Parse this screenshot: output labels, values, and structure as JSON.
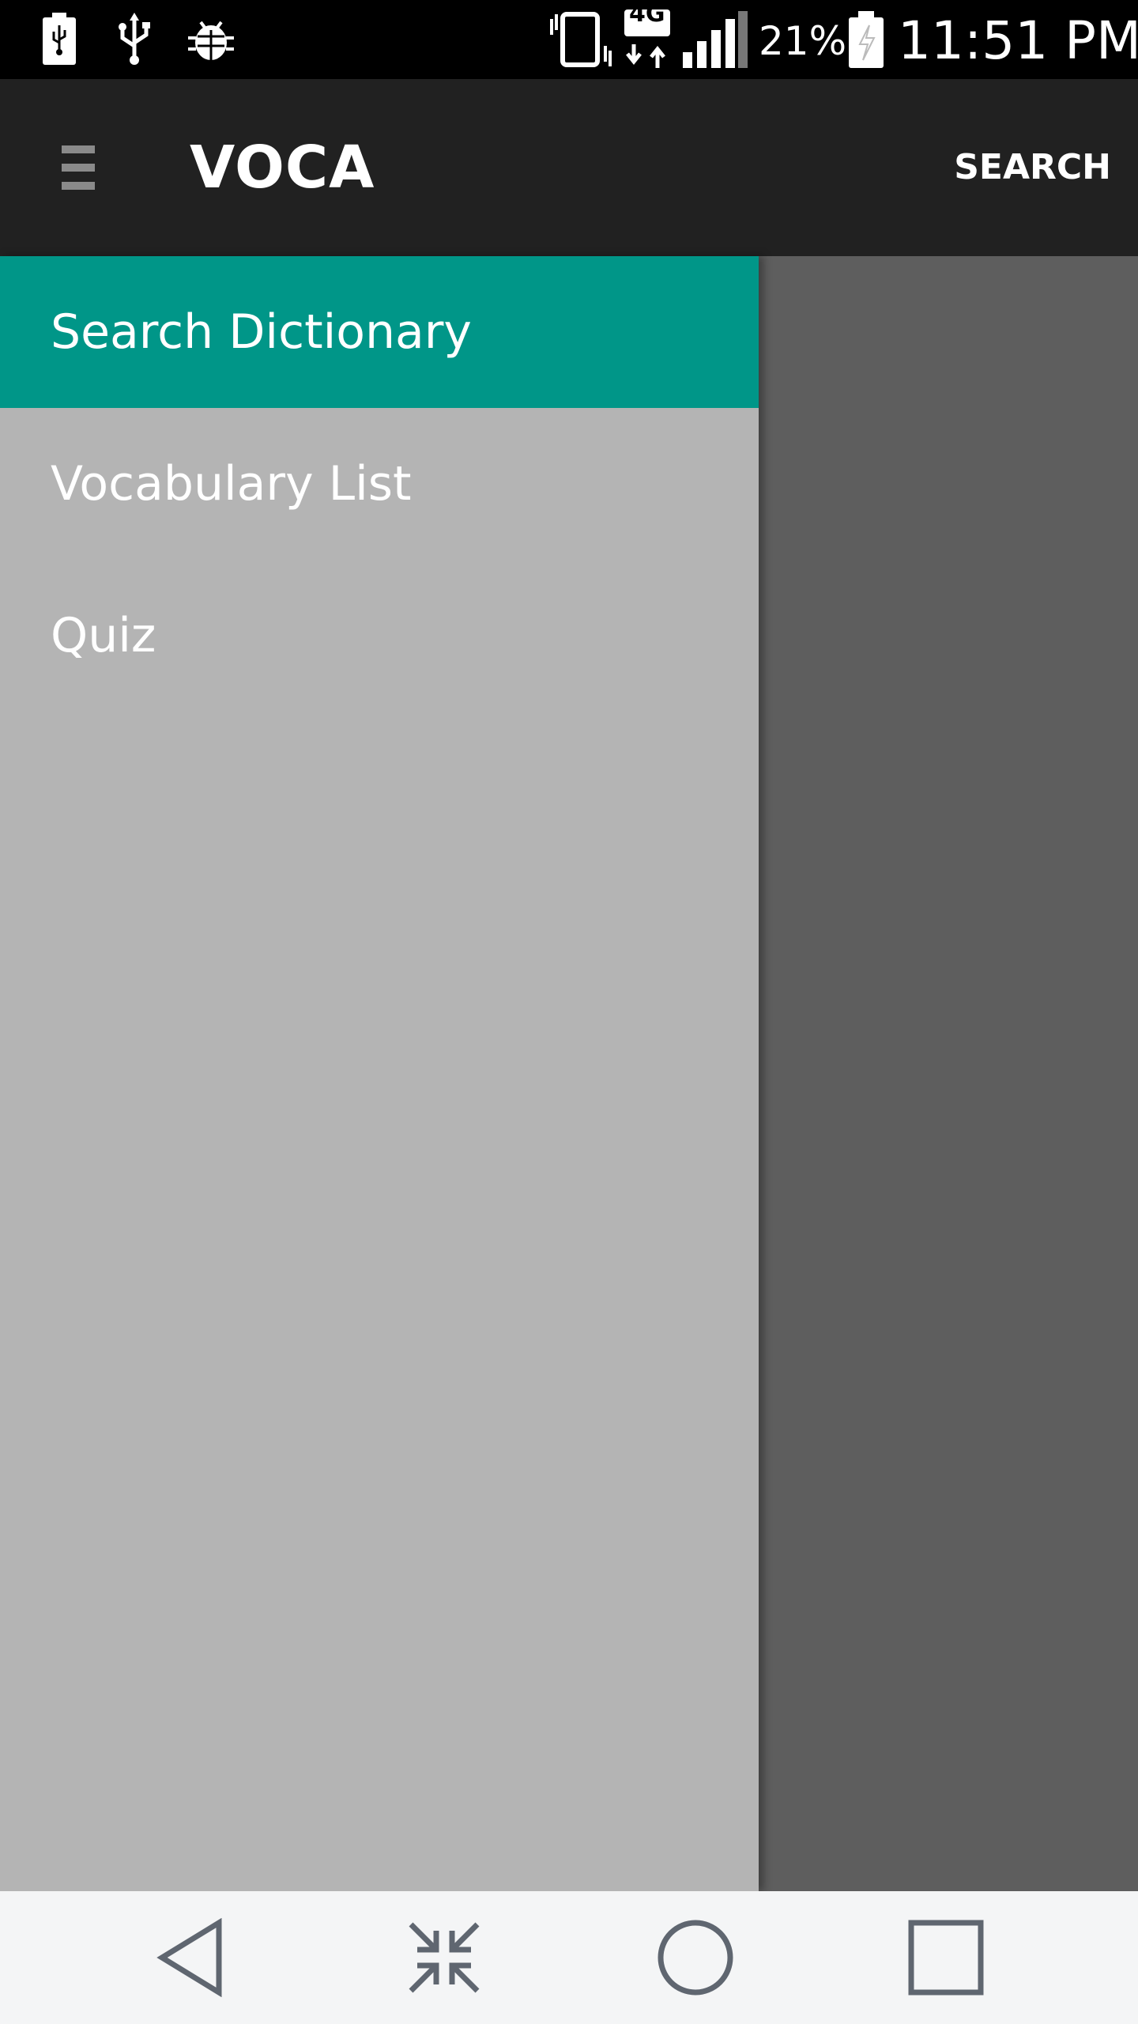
{
  "status_bar": {
    "battery_percent": "21%",
    "time": "11:51 PM",
    "network_type": "4G",
    "icons": [
      "battery-charging-icon",
      "usb-icon",
      "debug-icon",
      "vibrate-icon",
      "network-4g-icon",
      "signal-icon",
      "battery-icon"
    ]
  },
  "app_bar": {
    "menu_icon": "hamburger-menu-icon",
    "title": "VOCA",
    "action_label": "SEARCH"
  },
  "drawer": {
    "items": [
      {
        "label": "Search Dictionary",
        "selected": true
      },
      {
        "label": "Vocabulary List",
        "selected": false
      },
      {
        "label": "Quiz",
        "selected": false
      }
    ]
  },
  "nav_bar": {
    "buttons": [
      "back-icon",
      "collapse-icon",
      "home-icon",
      "recents-icon"
    ]
  },
  "colors": {
    "status_bar_bg": "#000000",
    "app_bar_bg": "#212121",
    "drawer_bg": "#b4b4b4",
    "selected_item_bg": "#009688",
    "scrim_bg": "#5e5e5e",
    "nav_bar_bg": "#f4f5f6",
    "nav_icon_color": "#5f6670"
  }
}
